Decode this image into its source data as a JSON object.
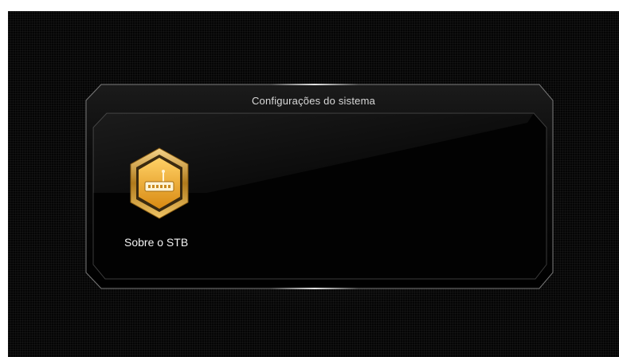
{
  "window": {
    "title": "Configurações do sistema"
  },
  "menu": {
    "items": [
      {
        "label": "Sobre o STB",
        "icon": "set-top-box-icon"
      }
    ]
  },
  "colors": {
    "background": "#050505",
    "icon_gold": "#e8a82a",
    "frame_border": "#8a8a8a",
    "text": "#f2f2f2"
  }
}
